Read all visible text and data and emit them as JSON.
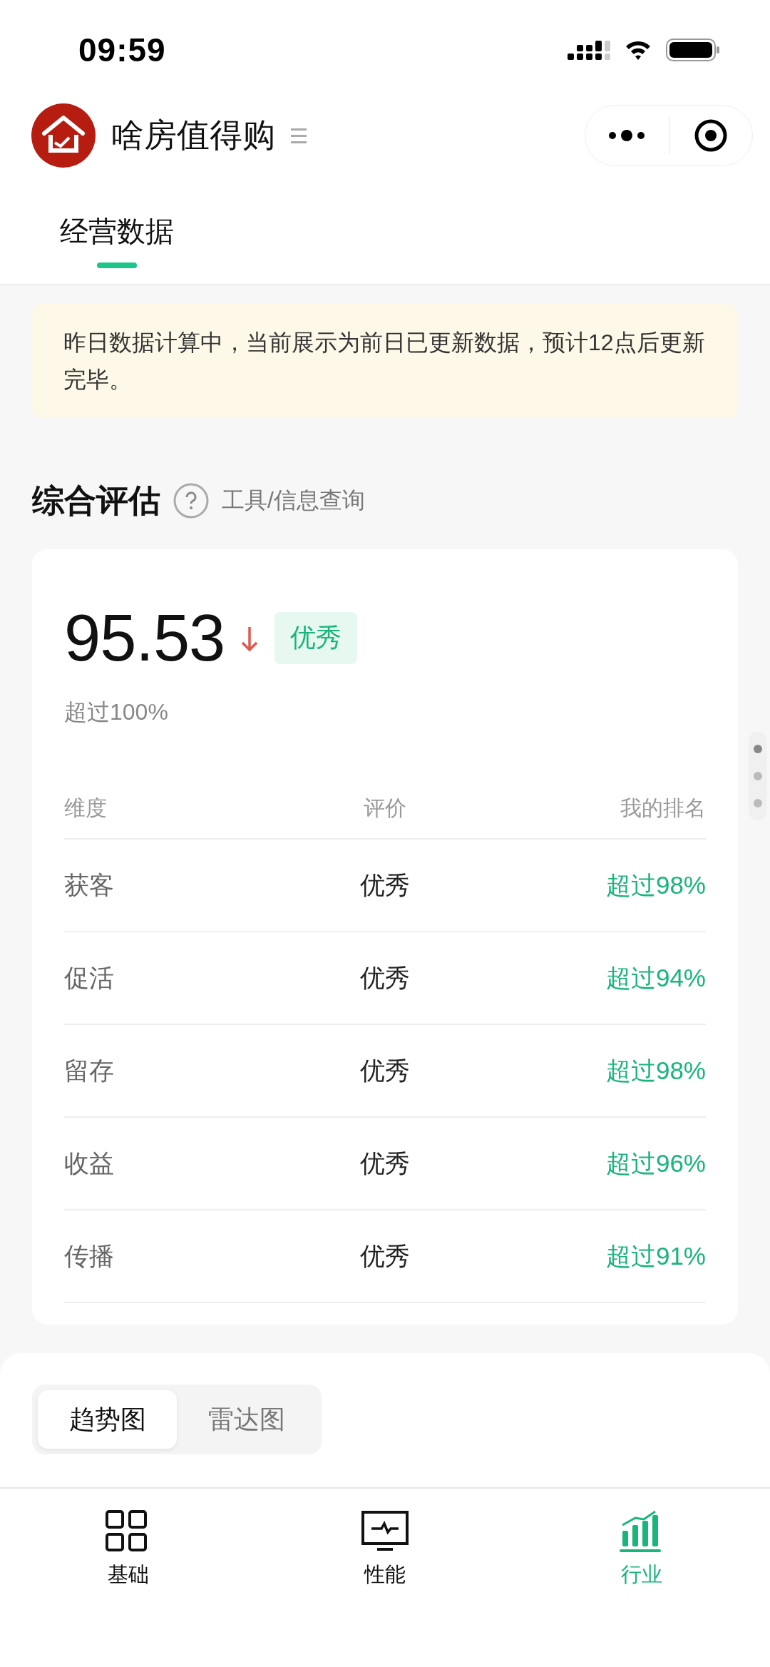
{
  "status_bar": {
    "time": "09:59"
  },
  "header": {
    "title": "啥房值得购"
  },
  "tabs": [
    {
      "label": "经营数据",
      "selected": true
    }
  ],
  "notice": "昨日数据计算中，当前展示为前日已更新数据，预计12点后更新完毕。",
  "evaluation": {
    "title": "综合评估",
    "link": "工具/信息查询",
    "score": "95.53",
    "falling": true,
    "grade": "优秀",
    "percentile": "超过100%",
    "columns": [
      "维度",
      "评价",
      "我的排名"
    ],
    "rows": [
      {
        "dimension": "获客",
        "rating": "优秀",
        "rank": "超过98%"
      },
      {
        "dimension": "促活",
        "rating": "优秀",
        "rank": "超过94%"
      },
      {
        "dimension": "留存",
        "rating": "优秀",
        "rank": "超过98%"
      },
      {
        "dimension": "收益",
        "rating": "优秀",
        "rank": "超过96%"
      },
      {
        "dimension": "传播",
        "rating": "优秀",
        "rank": "超过91%"
      }
    ]
  },
  "chart_tabs": [
    {
      "label": "趋势图",
      "selected": true
    },
    {
      "label": "雷达图",
      "selected": false
    }
  ],
  "nav": [
    {
      "label": "基础",
      "selected": false
    },
    {
      "label": "性能",
      "selected": false
    },
    {
      "label": "行业",
      "selected": true
    }
  ]
}
